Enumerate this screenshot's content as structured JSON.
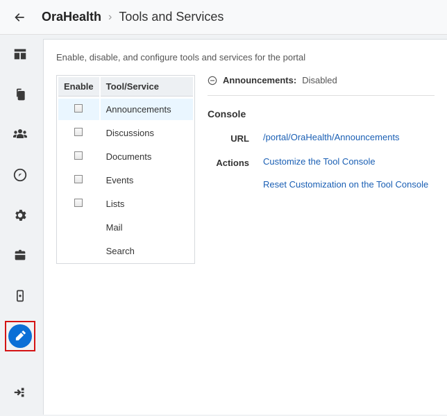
{
  "breadcrumb": {
    "portal": "OraHealth",
    "page": "Tools and Services"
  },
  "intro": "Enable, disable, and configure tools and services for the portal",
  "table": {
    "col_enable": "Enable",
    "col_service": "Tool/Service",
    "rows": [
      {
        "label": "Announcements",
        "checkbox": true,
        "selected": true
      },
      {
        "label": "Discussions",
        "checkbox": true,
        "selected": false
      },
      {
        "label": "Documents",
        "checkbox": true,
        "selected": false
      },
      {
        "label": "Events",
        "checkbox": true,
        "selected": false
      },
      {
        "label": "Lists",
        "checkbox": true,
        "selected": false
      },
      {
        "label": "Mail",
        "checkbox": false,
        "selected": false
      },
      {
        "label": "Search",
        "checkbox": false,
        "selected": false
      }
    ]
  },
  "detail": {
    "title": "Announcements",
    "status": "Disabled",
    "console_heading": "Console",
    "url_label": "URL",
    "url_value": "/portal/OraHealth/Announcements",
    "actions_label": "Actions",
    "action_customize": "Customize the Tool Console",
    "action_reset": "Reset Customization on the Tool Console"
  }
}
